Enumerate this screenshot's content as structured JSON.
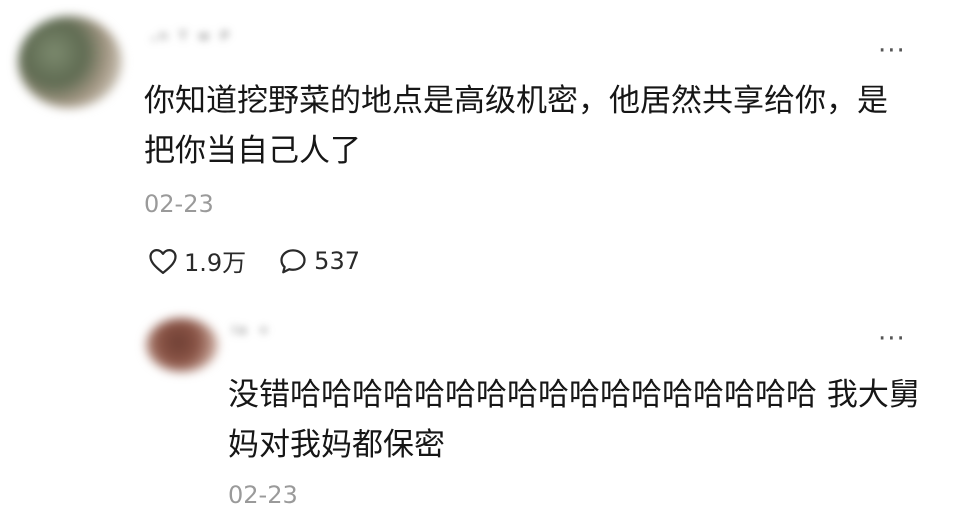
{
  "main_comment": {
    "username": "·ⁿ ᵀ ʷ ᴾ",
    "more_icon": "···",
    "text_line1": "你知道挖野菜的地点是高级机密，他居然共享给你，是",
    "text_line2": "把你当自己人了",
    "date": "02-23",
    "likes": "1.9万",
    "replies": "537"
  },
  "reply": {
    "username": "ᴵᵃ ⁺",
    "more_icon": "···",
    "text_line1": "没错哈哈哈哈哈哈哈哈哈哈哈哈哈哈哈哈哈 我大舅",
    "text_line2": "妈对我妈都保密",
    "date": "02-23"
  }
}
